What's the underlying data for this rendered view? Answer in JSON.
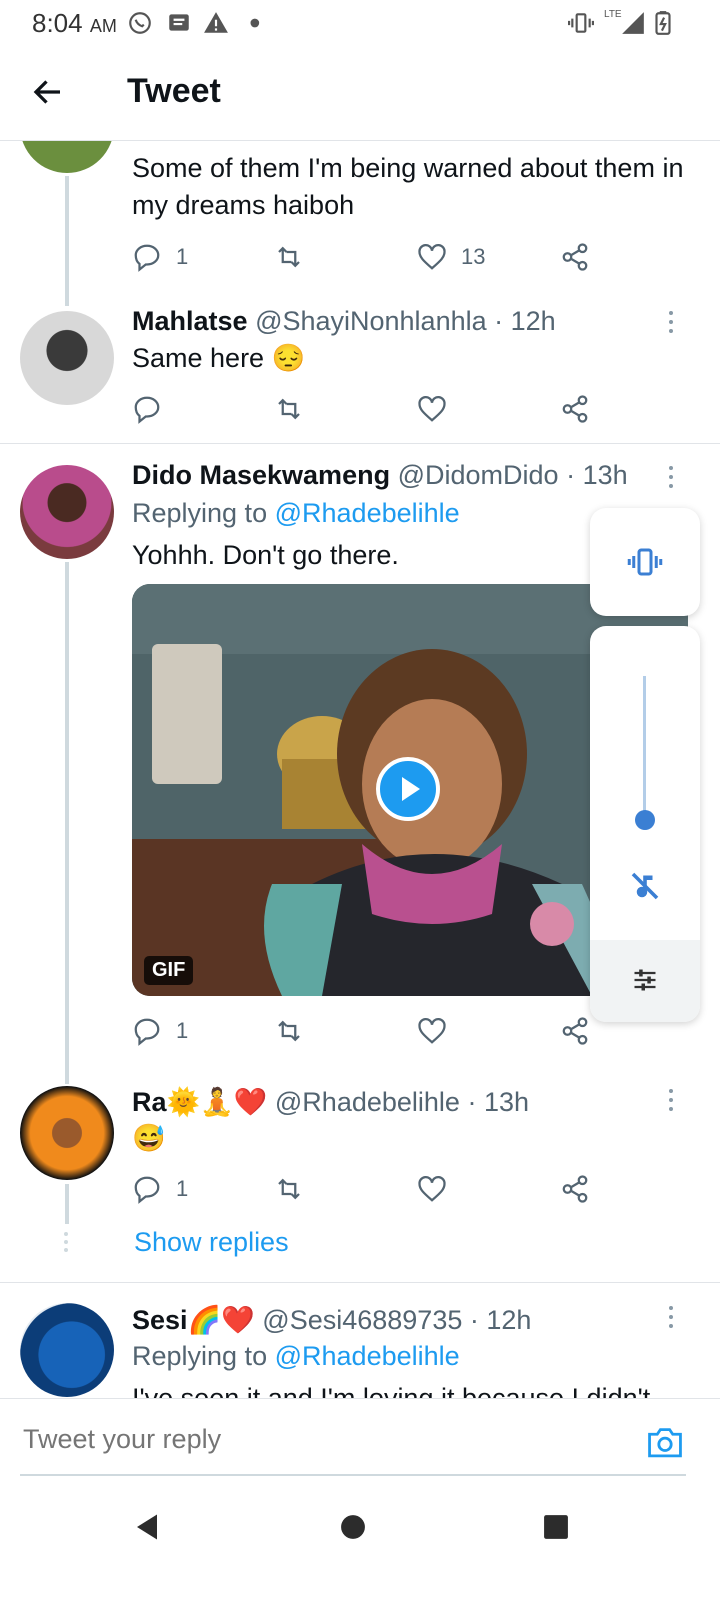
{
  "status_bar": {
    "time": "8:04",
    "ampm": "AM",
    "network": "LTE"
  },
  "header": {
    "title": "Tweet"
  },
  "tweets": [
    {
      "text": "Some of them I'm being warned about them in my dreams haiboh",
      "replies": "1",
      "likes": "13"
    },
    {
      "name": "Mahlatse",
      "handle": "@ShayiNonhlanhla",
      "time": "· 12h",
      "text": "Same here 😔"
    },
    {
      "name": "Dido Masekwameng",
      "handle": "@DidomDido",
      "time": "· 13h",
      "replying_label": "Replying to",
      "replying_to": "@Rhadebelihle",
      "text": "Yohhh. Don't go there.",
      "media_badge": "GIF",
      "replies": "1"
    },
    {
      "name": "Ra🌞🧘❤️",
      "handle": "@Rhadebelihle",
      "time": "· 13h",
      "text": "😅",
      "replies": "1",
      "show_replies": "Show replies"
    },
    {
      "name": "Sesi🌈❤️",
      "handle": "@Sesi46889735",
      "time": "· 12h",
      "replying_label": "Replying to",
      "replying_to": "@Rhadebelihle",
      "text": "I've seen it and I'm loving it because I didn't"
    }
  ],
  "reply_bar": {
    "placeholder": "Tweet your reply"
  },
  "volume_panel": {
    "level": 0.15
  },
  "colors": {
    "accent": "#1d9bf0",
    "text": "#0f1419",
    "muted": "#536471"
  }
}
